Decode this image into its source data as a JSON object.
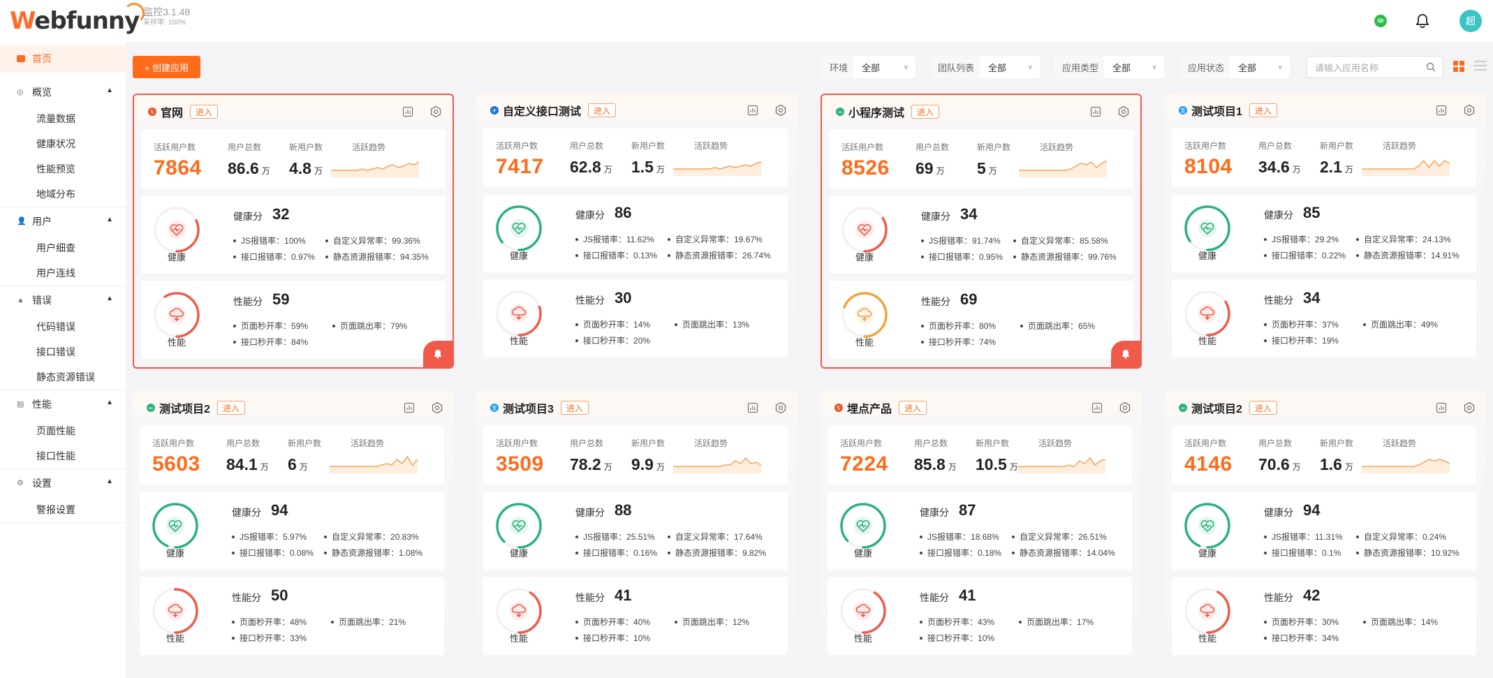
{
  "app": {
    "logo": "Webfunny",
    "version": "监控3.1.48",
    "sample_label": "采样率:",
    "sample_rate": "100%",
    "avatar": "超"
  },
  "sidebar": {
    "home": "首页",
    "groups": [
      {
        "label": "概览",
        "items": [
          "流量数据",
          "健康状况",
          "性能预览",
          "地域分布"
        ]
      },
      {
        "label": "用户",
        "items": [
          "用户细查",
          "用户连线"
        ]
      },
      {
        "label": "错误",
        "items": [
          "代码错误",
          "接口错误",
          "静态资源错误"
        ]
      },
      {
        "label": "性能",
        "items": [
          "页面性能",
          "接口性能"
        ]
      },
      {
        "label": "设置",
        "items": [
          "警报设置"
        ]
      }
    ]
  },
  "toolbar": {
    "create": "+ 创建应用",
    "filters": [
      {
        "label": "环境",
        "value": "全部"
      },
      {
        "label": "团队列表",
        "value": "全部"
      },
      {
        "label": "应用类型",
        "value": "全部"
      },
      {
        "label": "应用状态",
        "value": "全部"
      }
    ],
    "search_placeholder": "请输入应用名称"
  },
  "labels": {
    "enter": "进入",
    "active": "活跃用户数",
    "total": "用户总数",
    "new": "新用户数",
    "trend": "活跃趋势",
    "health": "健康",
    "health_score": "健康分",
    "perf": "性能",
    "perf_score": "性能分",
    "js": "JS报错率：",
    "custom": "自定义异常率：",
    "api": "接口报错率：",
    "static": "静态资源报错率：",
    "page_open": "页面秒开率：",
    "bounce": "页面跳出率：",
    "api_open": "接口秒开率：",
    "wan": "万"
  },
  "colors": {
    "accent": "#ff6b1a",
    "alert": "#f05a4a",
    "good": "#2ab27b",
    "warn": "#f2a33a"
  },
  "apps": [
    {
      "name": "官网",
      "icon": "html5-icon",
      "selected": true,
      "active": "7864",
      "total": "86.6",
      "new": "4.8",
      "trend": [
        4,
        4,
        4,
        4,
        4,
        4,
        5,
        4,
        5,
        6,
        5,
        7,
        8,
        6,
        7,
        9,
        8,
        10
      ],
      "health": {
        "score": "32",
        "js": "100%",
        "custom": "99.36%",
        "api": "0.97%",
        "static": "94.35%"
      },
      "perf": {
        "score": "59",
        "page_open": "59%",
        "bounce": "79%",
        "api_open": "84%"
      }
    },
    {
      "name": "自定义接口测试",
      "icon": "api-icon",
      "selected": false,
      "active": "7417",
      "total": "62.8",
      "new": "1.5",
      "trend": [
        4,
        4,
        4,
        4,
        4,
        4,
        4,
        4,
        5,
        4,
        5,
        6,
        5,
        6,
        7,
        6,
        8,
        9
      ],
      "health": {
        "score": "86",
        "js": "11.62%",
        "custom": "19.67%",
        "api": "0.13%",
        "static": "26.74%"
      },
      "perf": {
        "score": "30",
        "page_open": "14%",
        "bounce": "13%",
        "api_open": "20%"
      }
    },
    {
      "name": "小程序测试",
      "icon": "miniprogram-icon",
      "selected": true,
      "active": "8526",
      "total": "69",
      "new": "5",
      "trend": [
        4,
        4,
        4,
        4,
        4,
        4,
        4,
        4,
        4,
        4,
        5,
        7,
        9,
        8,
        10,
        6,
        9,
        11
      ],
      "health": {
        "score": "34",
        "js": "91.74%",
        "custom": "85.58%",
        "api": "0.95%",
        "static": "99.76%"
      },
      "perf": {
        "score": "69",
        "page_open": "80%",
        "bounce": "65%",
        "api_open": "74%"
      }
    },
    {
      "name": "测试项目1",
      "icon": "alipay-icon",
      "selected": false,
      "active": "8104",
      "total": "34.6",
      "new": "2.1",
      "trend": [
        4,
        4,
        4,
        4,
        4,
        4,
        4,
        4,
        4,
        4,
        4,
        6,
        10,
        5,
        10,
        6,
        10,
        8
      ],
      "health": {
        "score": "85",
        "js": "29.2%",
        "custom": "24.13%",
        "api": "0.22%",
        "static": "14.91%"
      },
      "perf": {
        "score": "34",
        "page_open": "37%",
        "bounce": "49%",
        "api_open": "19%"
      }
    },
    {
      "name": "测试项目2",
      "icon": "miniprogram-icon",
      "selected": false,
      "active": "5603",
      "total": "84.1",
      "new": "6",
      "trend": [
        4,
        4,
        4,
        4,
        4,
        4,
        4,
        4,
        4,
        4,
        5,
        6,
        5,
        9,
        6,
        11,
        5,
        9
      ],
      "health": {
        "score": "94",
        "js": "5.97%",
        "custom": "20.83%",
        "api": "0.08%",
        "static": "1.08%"
      },
      "perf": {
        "score": "50",
        "page_open": "48%",
        "bounce": "21%",
        "api_open": "33%"
      }
    },
    {
      "name": "测试项目3",
      "icon": "alipay-icon",
      "selected": false,
      "active": "3509",
      "total": "78.2",
      "new": "9.9",
      "trend": [
        4,
        4,
        4,
        4,
        4,
        4,
        4,
        4,
        4,
        4,
        5,
        5,
        8,
        6,
        10,
        6,
        7,
        5
      ],
      "health": {
        "score": "88",
        "js": "25.51%",
        "custom": "17.64%",
        "api": "0.16%",
        "static": "9.82%"
      },
      "perf": {
        "score": "41",
        "page_open": "40%",
        "bounce": "12%",
        "api_open": "10%"
      }
    },
    {
      "name": "埋点产品",
      "icon": "html5-icon",
      "selected": false,
      "active": "7224",
      "total": "85.8",
      "new": "10.5",
      "trend": [
        4,
        4,
        4,
        4,
        4,
        4,
        4,
        4,
        4,
        4,
        5,
        4,
        8,
        6,
        10,
        5,
        8,
        9
      ],
      "health": {
        "score": "87",
        "js": "18.68%",
        "custom": "26.51%",
        "api": "0.18%",
        "static": "14.04%"
      },
      "perf": {
        "score": "41",
        "page_open": "43%",
        "bounce": "17%",
        "api_open": "10%"
      }
    },
    {
      "name": "测试项目2",
      "icon": "miniprogram-icon",
      "selected": false,
      "active": "4146",
      "total": "70.6",
      "new": "1.6",
      "trend": [
        4,
        4,
        4,
        4,
        4,
        4,
        4,
        4,
        4,
        4,
        4,
        5,
        7,
        9,
        8,
        9,
        8,
        6
      ],
      "health": {
        "score": "94",
        "js": "11.31%",
        "custom": "0.24%",
        "api": "0.1%",
        "static": "10.92%"
      },
      "perf": {
        "score": "42",
        "page_open": "30%",
        "bounce": "14%",
        "api_open": "34%"
      }
    }
  ]
}
